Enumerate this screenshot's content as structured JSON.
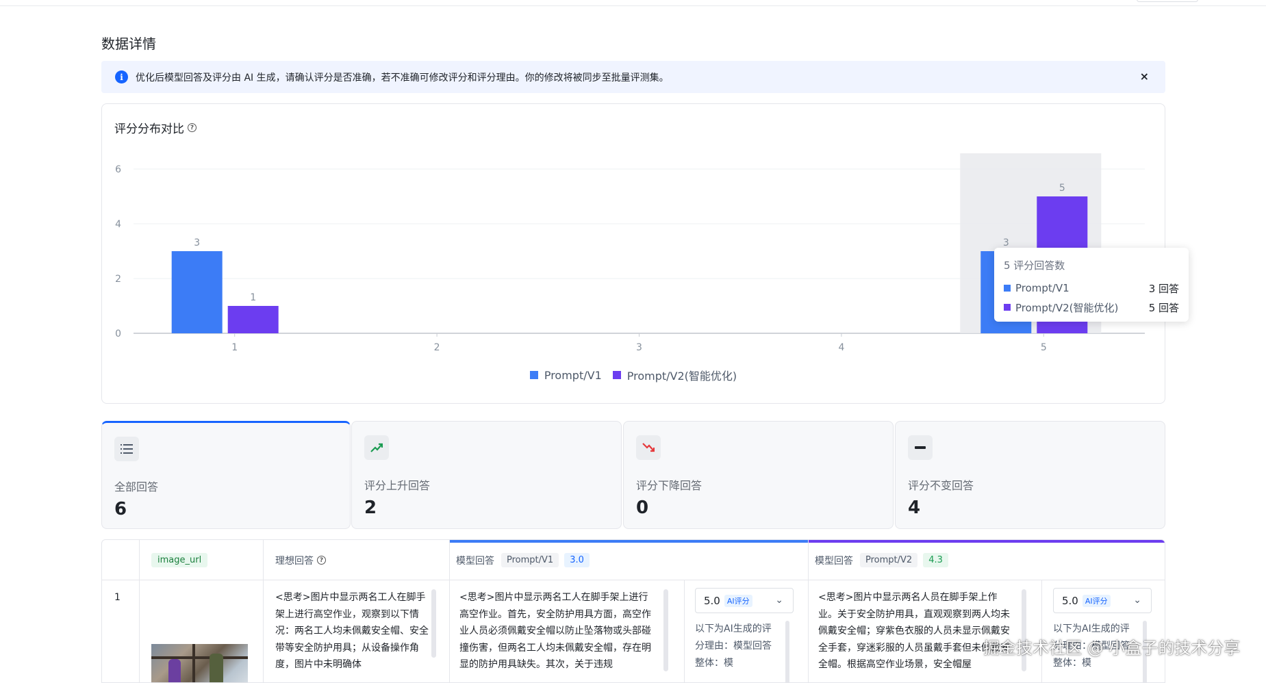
{
  "page": {
    "title": "数据详情"
  },
  "alert": {
    "message": "优化后模型回答及评分由 AI 生成，请确认评分是否准确，若不准确可修改评分和评分理由。你的修改将被同步至批量评测集。",
    "close": "×"
  },
  "chart": {
    "title": "评分分布对比"
  },
  "chart_data": {
    "type": "bar",
    "categories": [
      "1",
      "2",
      "3",
      "4",
      "5"
    ],
    "series": [
      {
        "name": "Prompt/V1",
        "values": [
          3,
          0,
          0,
          0,
          3
        ],
        "color": "#3c7cf6"
      },
      {
        "name": "Prompt/V2(智能优化)",
        "values": [
          1,
          0,
          0,
          0,
          5
        ],
        "color": "#6c3df0"
      }
    ],
    "ylim": [
      0,
      6
    ],
    "yticks": [
      "0",
      "2",
      "4",
      "6"
    ],
    "legend": "bottom",
    "grid": true,
    "highlighted_category": "5"
  },
  "tooltip": {
    "title": "5 评分回答数",
    "rows": [
      {
        "name": "Prompt/V1",
        "value": "3 回答"
      },
      {
        "name": "Prompt/V2(智能优化)",
        "value": "5 回答"
      }
    ]
  },
  "stats": [
    {
      "label": "全部回答",
      "value": "6",
      "icon": "list-icon"
    },
    {
      "label": "评分上升回答",
      "value": "2",
      "icon": "trend-up-icon"
    },
    {
      "label": "评分下降回答",
      "value": "0",
      "icon": "trend-down-icon"
    },
    {
      "label": "评分不变回答",
      "value": "4",
      "icon": "minus-icon"
    }
  ],
  "table": {
    "headers": {
      "image": "image_url",
      "ideal": "理想回答",
      "model_v1_label": "模型回答",
      "model_v1_prompt": "Prompt/V1",
      "model_v1_score": "3.0",
      "model_v2_label": "模型回答",
      "model_v2_prompt": "Prompt/V2",
      "model_v2_score": "4.3"
    },
    "rows": [
      {
        "index": "1",
        "ideal": "<思考>图片中显示两名工人在脚手架上进行高空作业，观察到以下情况：两名工人均未佩戴安全帽、安全带等安全防护用具；从设备操作角度，图片中未明确体",
        "v1_answer": "<思考>图片中显示两名工人在脚手架上进行高空作业。首先，安全防护用具方面，高空作业人员必须佩戴安全帽以防止坠落物或头部碰撞伤害，但两名工人均未佩戴安全帽，存在明显的防护用具缺失。其次，关于违规",
        "v1_score": "5.0",
        "v1_ai_tag": "AI评分",
        "v1_reason": "以下为AI生成的评分理由：模型回答整体：模",
        "v2_answer": "<思考>图片中显示两名人员在脚手架上作业。关于安全防护用具，直观观察到两人均未佩戴安全帽；穿紫色衣服的人员未显示佩戴安全手套，穿迷彩服的人员虽戴手套但未佩戴安全帽。根据高空作业场景，安全帽屋",
        "v2_score": "5.0",
        "v2_ai_tag": "AI评分",
        "v2_reason": "以下为AI生成的评分理由：模型回答整体：模"
      }
    ]
  },
  "watermark": "掘金技术社区 @ 小盒子的技术分享"
}
